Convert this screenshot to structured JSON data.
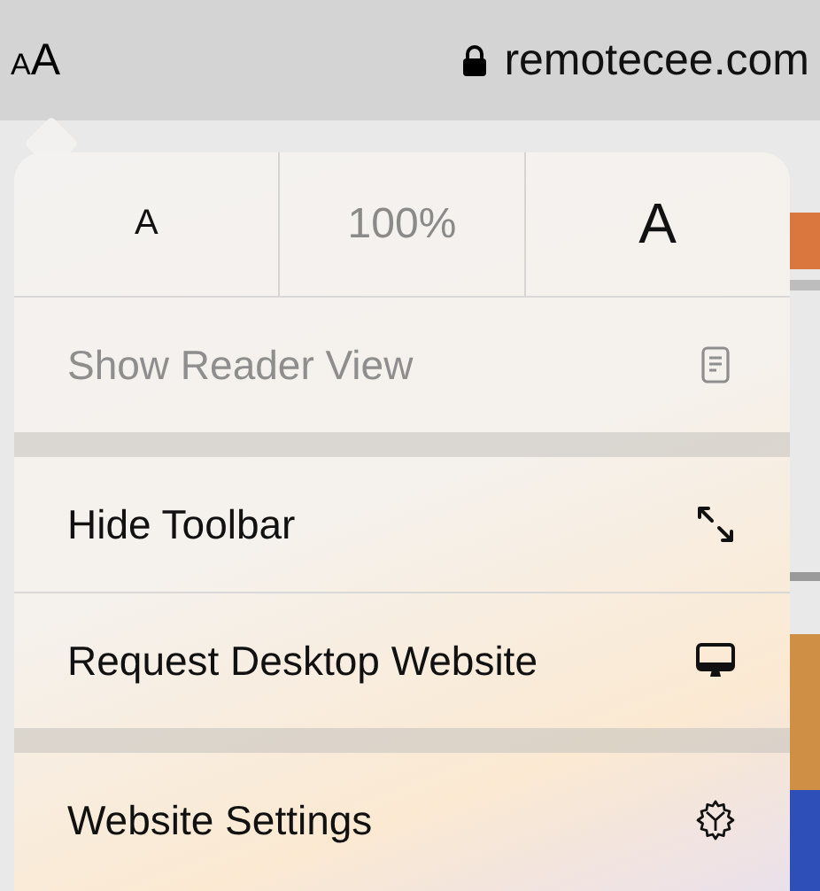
{
  "address_bar": {
    "format_button": {
      "small": "A",
      "large": "A"
    },
    "secure": true,
    "url": "remotecee.com"
  },
  "menu": {
    "text_size": {
      "smaller": "A",
      "zoom": "100%",
      "larger": "A"
    },
    "groups": [
      {
        "items": [
          {
            "label": "Show Reader View",
            "disabled": true
          }
        ]
      },
      {
        "items": [
          {
            "label": "Hide Toolbar",
            "disabled": false
          },
          {
            "label": "Request Desktop Website",
            "disabled": false
          }
        ]
      },
      {
        "items": [
          {
            "label": "Website Settings",
            "disabled": false
          }
        ]
      }
    ]
  }
}
